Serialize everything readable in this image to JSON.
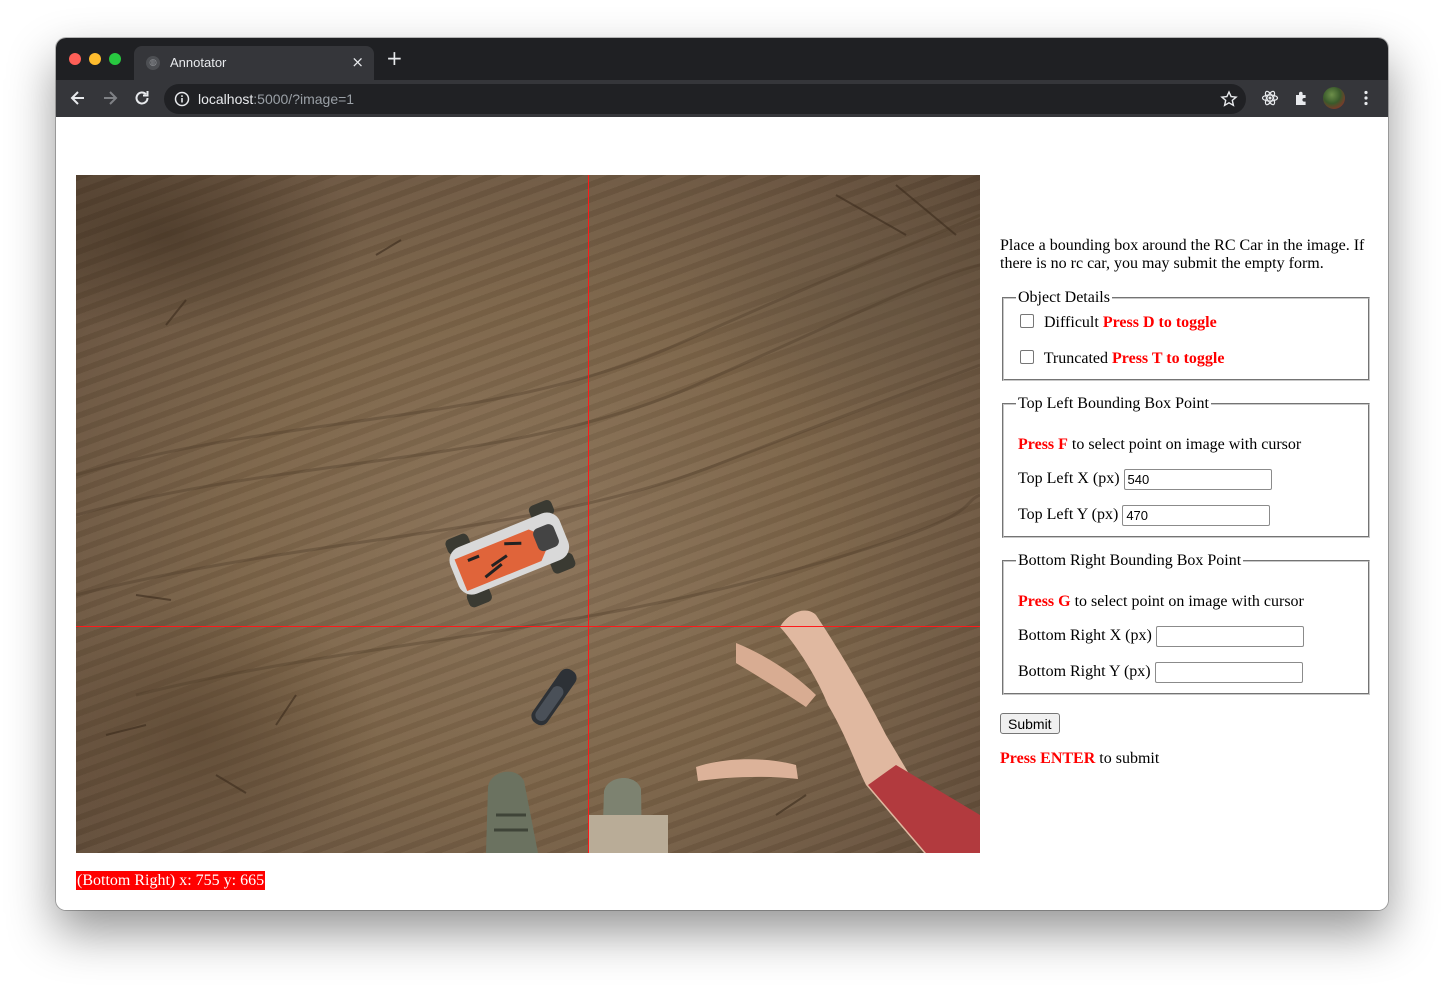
{
  "browser": {
    "tab_title": "Annotator",
    "tab_close": "×",
    "new_tab": "+",
    "url_host": "localhost",
    "url_rest": ":5000/?image=1"
  },
  "photo": {
    "description_alt": "RC car on dirt track"
  },
  "coord_label": "(Bottom Right) x: 755 y: 665",
  "side": {
    "instructions": "Place a bounding box around the RC Car in the image. If there is no rc car, you may submit the empty form.",
    "object_details": {
      "legend": "Object Details",
      "difficult_label": "Difficult",
      "difficult_hint": "Press D to toggle",
      "truncated_label": "Truncated",
      "truncated_hint": "Press T to toggle"
    },
    "top_left": {
      "legend": "Top Left Bounding Box Point",
      "press": "Press F",
      "press_rest": " to select point on image with cursor",
      "x_label": "Top Left X (px)",
      "x_value": "540",
      "y_label": "Top Left Y (px)",
      "y_value": "470"
    },
    "bottom_right": {
      "legend": "Bottom Right Bounding Box Point",
      "press": "Press G",
      "press_rest": " to select point on image with cursor",
      "x_label": "Bottom Right X (px)",
      "x_value": "",
      "y_label": "Bottom Right Y (px)",
      "y_value": ""
    },
    "submit_label": "Submit",
    "enter_press": "Press ENTER",
    "enter_rest": " to submit"
  },
  "colors": {
    "accent_red": "#ff0000",
    "crosshair": "#ff1a1a"
  }
}
